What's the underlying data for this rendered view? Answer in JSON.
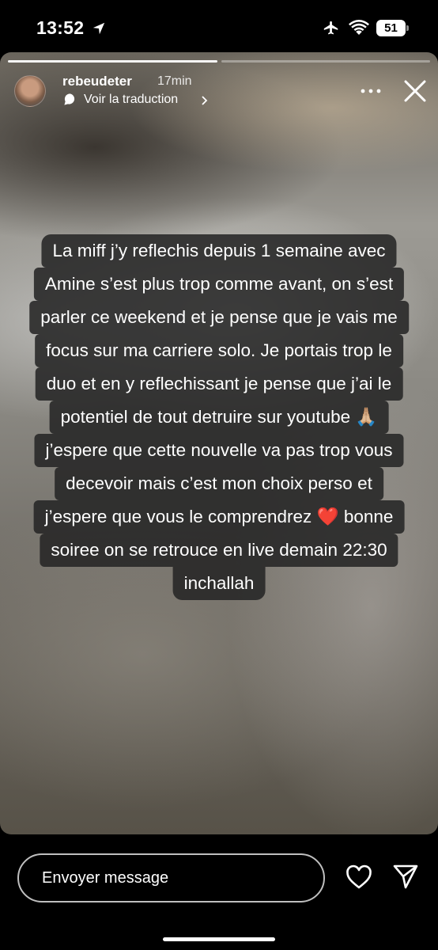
{
  "status_bar": {
    "time": "13:52",
    "battery": "51",
    "icons": [
      "location-arrow-icon",
      "airplane-icon",
      "wifi-icon",
      "battery-icon"
    ]
  },
  "story": {
    "progress": [
      1.0,
      0.0
    ],
    "username": "rebeudeter",
    "time_ago": "17min",
    "translate_label": "Voir la traduction",
    "lines": [
      "La miff j’y reflechis depuis 1 semaine avec",
      "Amine s’est plus trop comme avant, on s’est",
      "parler ce weekend et je pense que je vais me",
      "focus sur ma carriere solo. Je portais trop le",
      "duo et en y reflechissant je pense que j’ai le",
      "potentiel de tout detruire sur youtube 🙏🏼",
      "j’espere que cette nouvelle va pas trop vous",
      "decevoir mais c’est mon choix perso et",
      "j’espere que vous le comprendrez ❤️ bonne",
      "soiree on se retrouce en live demain 22:30",
      "inchallah"
    ]
  },
  "bottom_bar": {
    "message_placeholder": "Envoyer message"
  },
  "colors": {
    "text_bg": "#262626",
    "accent": "#ffffff"
  }
}
